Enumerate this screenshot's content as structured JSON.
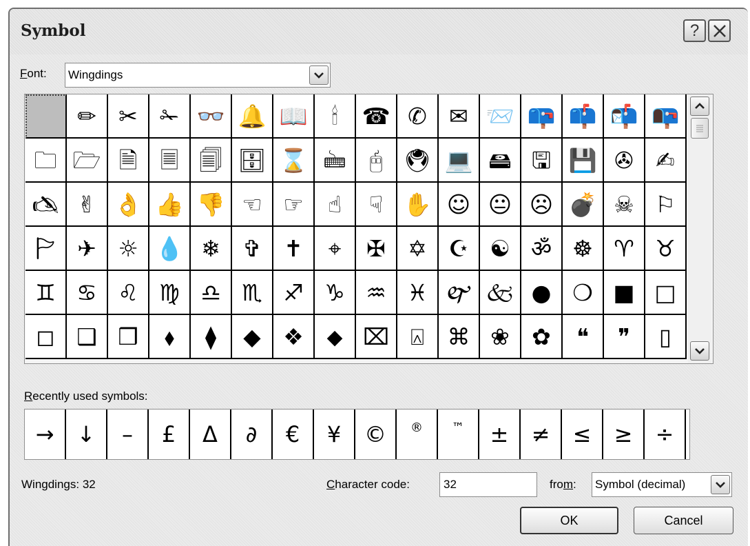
{
  "dialog": {
    "title": "Symbol",
    "help_label": "?",
    "close_label": "✕"
  },
  "font": {
    "label_underlined": "F",
    "label_rest": "ont:",
    "value": "Wingdings"
  },
  "symbols": [
    "",
    "✏",
    "✂",
    "✁",
    "👓",
    "🔔",
    "📖",
    "🕯",
    "☎",
    "✆",
    "✉",
    "📨",
    "📪",
    "📫",
    "📬",
    "📭",
    "🗀",
    "🗁",
    "🗎",
    "🗏",
    "🗐",
    "🗄",
    "⌛",
    "🖮",
    "🖰",
    "🖲",
    "💻",
    "🖴",
    "🖫",
    "💾",
    "✇",
    "✍",
    "🖎",
    "✌",
    "👌",
    "👍",
    "👎",
    "☜",
    "☞",
    "☝",
    "☟",
    "✋",
    "☺",
    "😐",
    "☹",
    "💣",
    "☠",
    "⚐",
    "🏱",
    "✈",
    "☼",
    "💧",
    "❄",
    "✞",
    "✝",
    "⌖",
    "✠",
    "✡",
    "☪",
    "☯",
    "ॐ",
    "☸",
    "♈",
    "♉",
    "♊",
    "♋",
    "♌",
    "♍",
    "♎",
    "♏",
    "♐",
    "♑",
    "♒",
    "♓",
    "🙰",
    "🙵",
    "●",
    "❍",
    "■",
    "□",
    "◻",
    "❑",
    "❒",
    "⬧",
    "⧫",
    "◆",
    "❖",
    "⬥",
    "⌧",
    "⍓",
    "⌘",
    "❀",
    "✿",
    "❝",
    "❞",
    "▯"
  ],
  "recent": {
    "label_underlined": "R",
    "label_rest": "ecently used symbols:",
    "symbols": [
      "→",
      "↓",
      "–",
      "£",
      "Δ",
      "∂",
      "€",
      "¥",
      "©",
      "®",
      "™",
      "±",
      "≠",
      "≤",
      "≥",
      "÷"
    ]
  },
  "status_text": "Wingdings: 32",
  "char_code": {
    "label_underlined": "C",
    "label_rest": "haracter code:",
    "value": "32"
  },
  "from": {
    "label_pre": "fro",
    "label_underlined": "m",
    "label_post": ":",
    "value": "Symbol (decimal)"
  },
  "buttons": {
    "ok": "OK",
    "cancel": "Cancel"
  }
}
